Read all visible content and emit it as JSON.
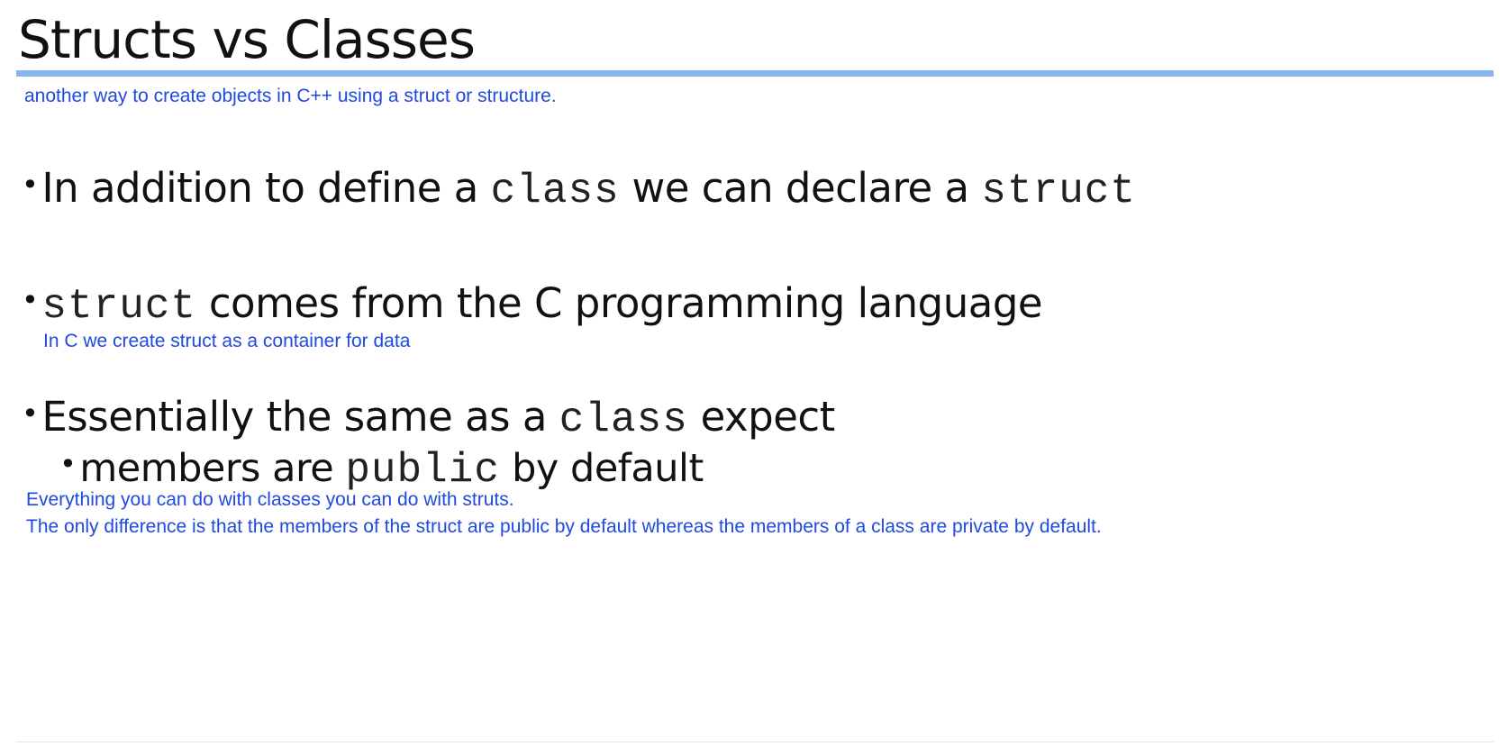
{
  "slide": {
    "title": "Structs vs Classes",
    "subtitle_note": "another way to create objects in C++ using a struct or structure.",
    "bullet_glyph": "•",
    "bullets": [
      {
        "part1": "In addition to define a ",
        "code1": "class",
        "part2": " we can declare a ",
        "code2": "struct"
      },
      {
        "code1": "struct",
        "part1": " comes from the C programming language",
        "note": "In C we create struct as a container for data"
      },
      {
        "part1": "Essentially the same as a ",
        "code1": "class",
        "part2": " expect",
        "sub": {
          "part1": "members are ",
          "code1": "public",
          "part2": " by default"
        }
      }
    ],
    "notes": [
      "Everything you can do with classes you can do with struts.",
      "The only difference is that the members of the struct are public by default whereas the members of a class are private by default."
    ]
  },
  "colors": {
    "title_rule": "#86b6ee",
    "note_text": "#1f49e0",
    "body_text": "#111111"
  }
}
